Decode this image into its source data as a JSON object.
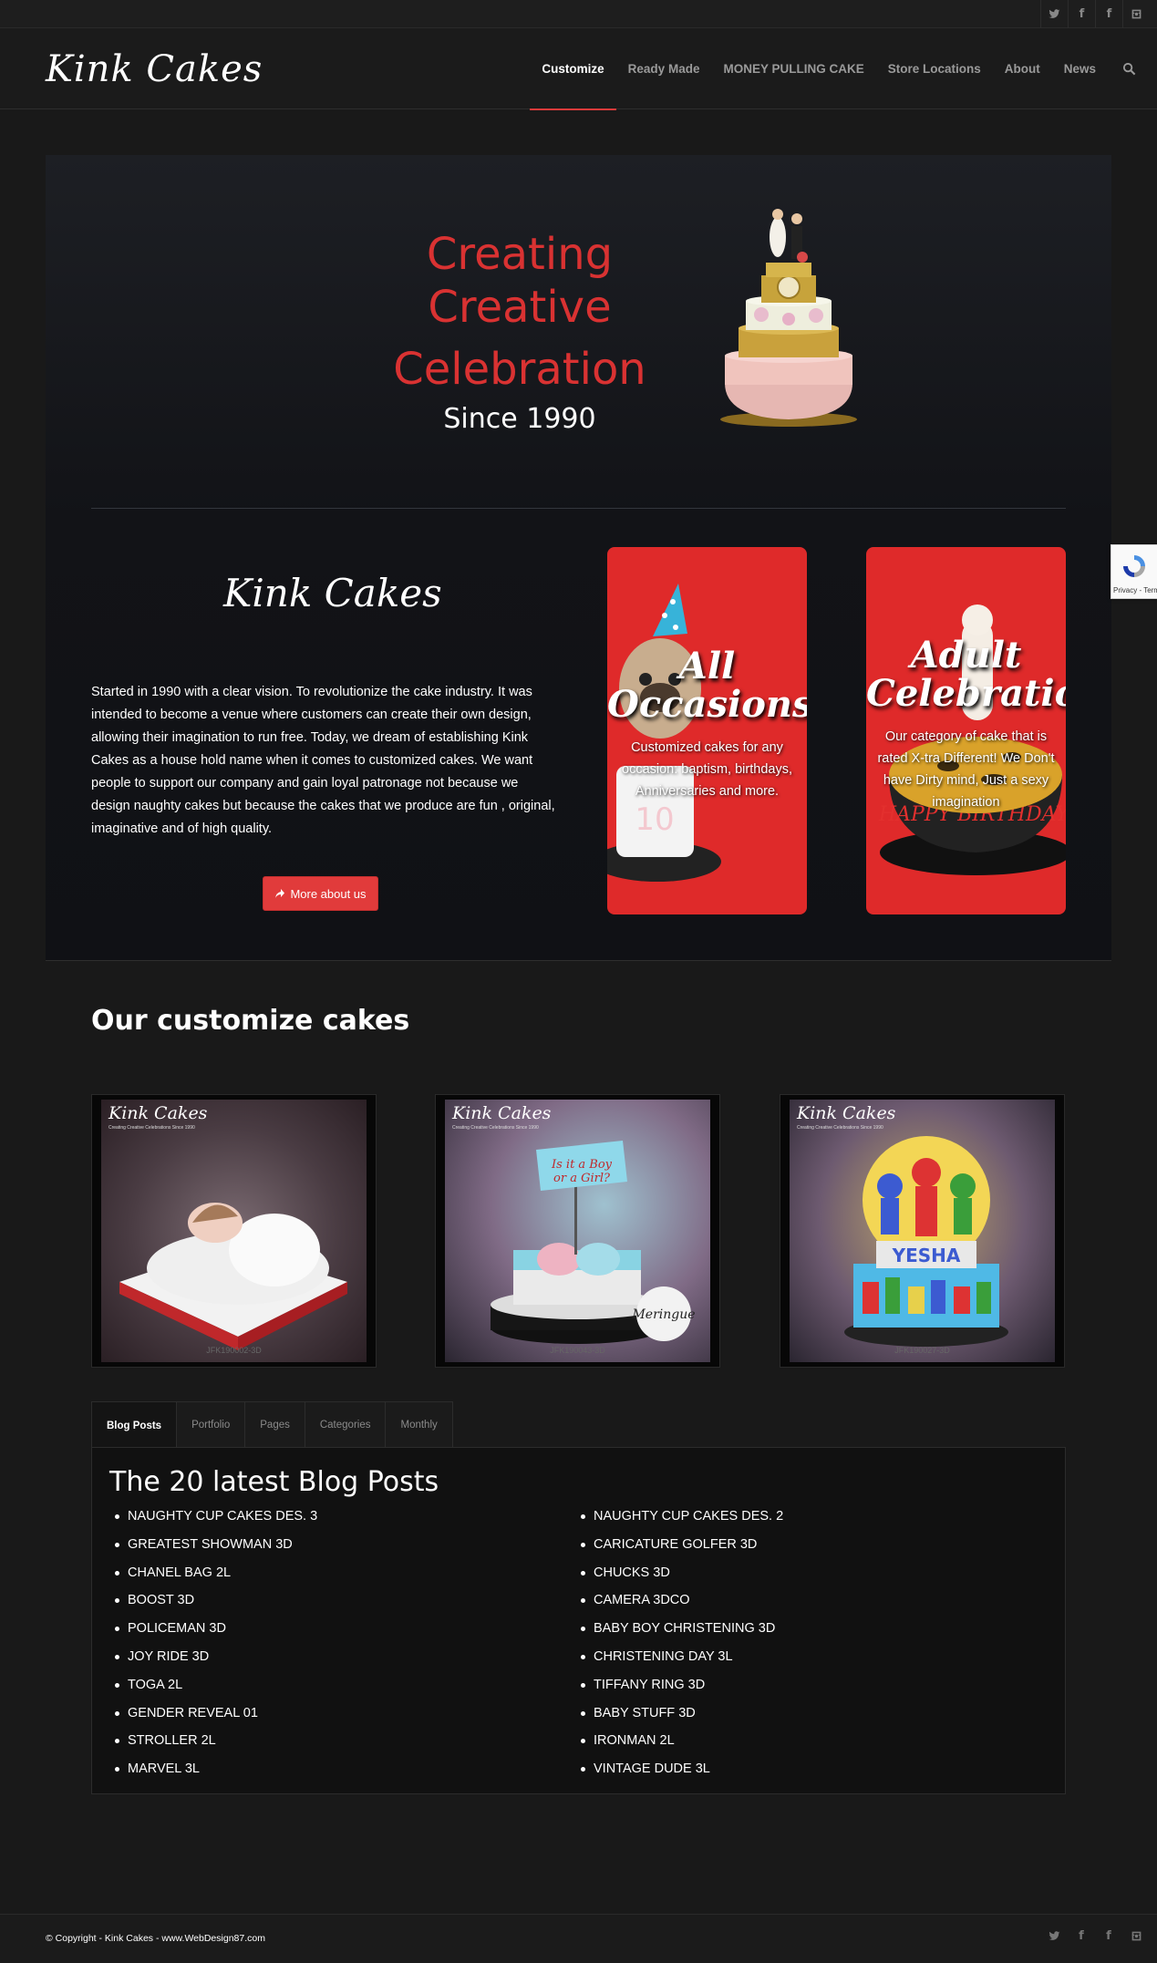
{
  "topbar": {
    "social": [
      {
        "name": "twitter-icon"
      },
      {
        "name": "facebook-icon",
        "glyph": "f"
      },
      {
        "name": "facebook-icon",
        "glyph": "f"
      },
      {
        "name": "instagram-icon"
      }
    ]
  },
  "header": {
    "logo": "Kink Cakes",
    "nav": [
      {
        "label": "Customize",
        "active": true
      },
      {
        "label": "Ready Made"
      },
      {
        "label": "MONEY PULLING CAKE"
      },
      {
        "label": "Store Locations"
      },
      {
        "label": "About"
      },
      {
        "label": "News"
      }
    ]
  },
  "hero": {
    "title_line1": "Creating",
    "title_line2": "Creative",
    "title_line3": "Celebration",
    "subtitle": "Since 1990"
  },
  "about": {
    "logo": "Kink Cakes",
    "text": "Started in 1990 with a clear vision. To revolutionize the cake industry. It was intended to become a venue where customers can create their own design, allowing their imagination to run free. Today, we dream of establishing Kink Cakes as a house hold name when it comes to customized cakes. We want people to support our company and gain loyal patronage not because we design naughty cakes but because the cakes that we produce are fun , original, imaginative and of high quality.",
    "button": "More about us"
  },
  "cards": [
    {
      "title_1": "All",
      "title_2": "Occasions",
      "desc": "Customized cakes for any occasion: baptism, birthdays, Anniversaries and more."
    },
    {
      "title_1": "Adult",
      "title_2": "Celebrations",
      "desc": "Our category of cake that is rated X-tra Different! We Don't have Dirty mind, Just a sexy imagination"
    }
  ],
  "recaptcha": {
    "text": "Privacy - Terms"
  },
  "customize": {
    "title": "Our customize cakes",
    "items": [
      {
        "logo": "Kink Cakes",
        "tagline": "Creating Creative Celebrations Since 1990",
        "code": "JFK190002-3D"
      },
      {
        "logo": "Kink Cakes",
        "tagline": "Creating Creative Celebrations Since 1990",
        "code": "JFK190043-3D"
      },
      {
        "logo": "Kink Cakes",
        "tagline": "Creating Creative Celebrations Since 1990",
        "code": "JFK190027-3D"
      }
    ]
  },
  "tabs": {
    "items": [
      "Blog Posts",
      "Portfolio",
      "Pages",
      "Categories",
      "Monthly"
    ],
    "active": "Blog Posts",
    "heading": "The 20 latest Blog Posts",
    "col1": [
      "NAUGHTY CUP CAKES DES. 3",
      "GREATEST SHOWMAN 3D",
      "CHANEL BAG 2L",
      "BOOST 3D",
      "POLICEMAN 3D",
      "JOY RIDE 3D",
      "TOGA 2L",
      "GENDER REVEAL 01",
      "STROLLER 2L",
      "MARVEL 3L"
    ],
    "col2": [
      "NAUGHTY CUP CAKES DES. 2",
      "CARICATURE GOLFER 3D",
      "CHUCKS 3D",
      "CAMERA 3DCO",
      "BABY BOY CHRISTENING 3D",
      "CHRISTENING DAY 3L",
      "TIFFANY RING 3D",
      "BABY STUFF 3D",
      "IRONMAN 2L",
      "VINTAGE DUDE 3L"
    ]
  },
  "footer": {
    "copyright": "© Copyright - Kink Cakes - www.WebDesign87.com"
  },
  "colors": {
    "accent": "#df2a2a",
    "background": "#191919"
  }
}
